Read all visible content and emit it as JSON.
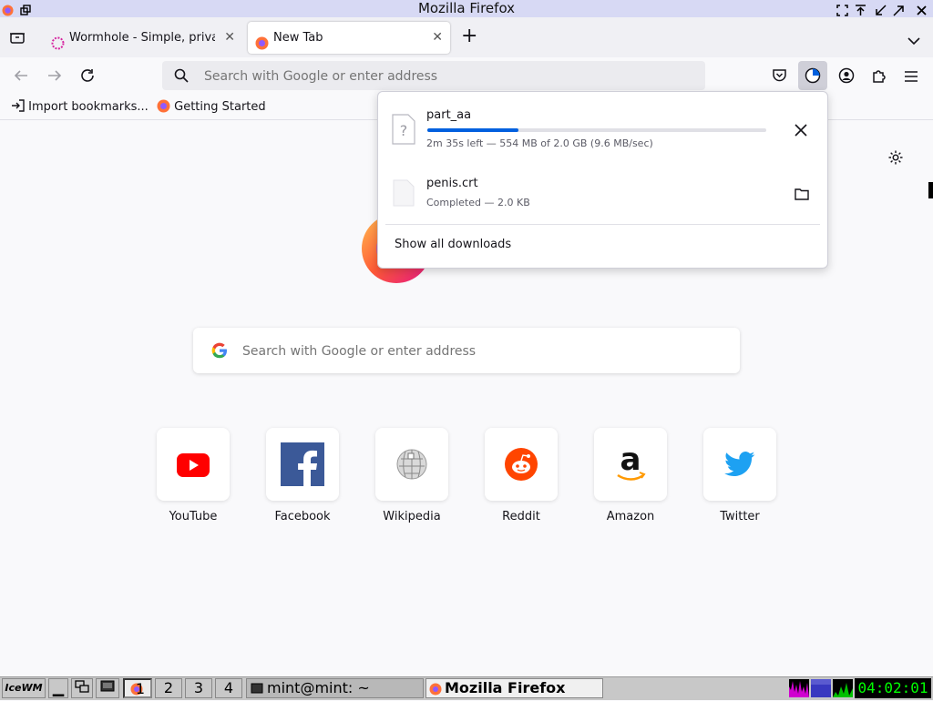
{
  "window": {
    "title": "Mozilla Firefox"
  },
  "tabs": [
    {
      "label": "Wormhole - Simple, privat",
      "active": false
    },
    {
      "label": "New Tab",
      "active": true
    }
  ],
  "navbar": {
    "url_placeholder": "Search with Google or enter address"
  },
  "bookmarks": [
    {
      "label": "Import bookmarks..."
    },
    {
      "label": "Getting Started"
    }
  ],
  "newtab": {
    "search_placeholder": "Search with Google or enter address",
    "top_sites": [
      {
        "label": "YouTube",
        "icon": "youtube-icon"
      },
      {
        "label": "Facebook",
        "icon": "facebook-icon"
      },
      {
        "label": "Wikipedia",
        "icon": "wikipedia-icon"
      },
      {
        "label": "Reddit",
        "icon": "reddit-icon"
      },
      {
        "label": "Amazon",
        "icon": "amazon-icon"
      },
      {
        "label": "Twitter",
        "icon": "twitter-icon"
      }
    ]
  },
  "downloads": {
    "items": [
      {
        "name": "part_aa",
        "status": "2m 35s left — 554 MB of 2.0 GB (9.6 MB/sec)",
        "progress": 0.27,
        "action": "cancel"
      },
      {
        "name": "penis.crt",
        "status": "Completed — 2.0 KB",
        "action": "open-folder"
      }
    ],
    "show_all_label": "Show all downloads"
  },
  "taskbar": {
    "logo": "IceWM",
    "workspaces": [
      "1",
      "2",
      "3",
      "4"
    ],
    "active_workspace": "1",
    "tasks": [
      {
        "label": "mint@mint: ~"
      },
      {
        "label": "Mozilla Firefox"
      }
    ],
    "clock": "04:02:01"
  },
  "colors": {
    "accent": "#0060df",
    "progress_track": "#e0e0e6",
    "titlebar_bg": "#d7d9f4",
    "clock_fg": "#00ff00",
    "clock_bg": "#000000"
  }
}
